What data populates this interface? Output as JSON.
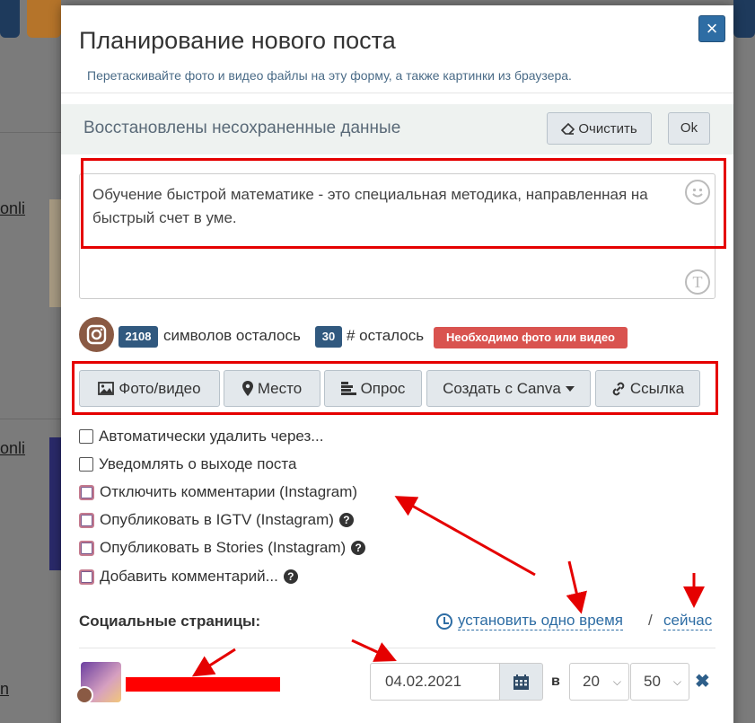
{
  "modal": {
    "title": "Планирование нового поста",
    "subtitle": "Перетаскивайте фото и видео файлы на эту форму, а также картинки из браузера.",
    "close_label": "×"
  },
  "background": {
    "link_1": "onli",
    "link_2": "onli",
    "link_3": "n"
  },
  "restored": {
    "text": "Восстановлены несохраненные данные",
    "clear_label": "Очистить",
    "ok_label": "Ok"
  },
  "editor": {
    "text": "Обучение быстрой математике - это специальная методика, направленная на быстрый счет в уме.",
    "emoji_icon": "smile-icon",
    "text_icon": "T"
  },
  "counters": {
    "chars_left": "2108",
    "chars_label": "символов осталось",
    "hashtags_left": "30",
    "hashtags_label": "# осталось",
    "warning": "Необходимо фото или видео"
  },
  "toolbar": {
    "photo_label": "Фото/видео",
    "place_label": "Место",
    "poll_label": "Опрос",
    "canva_label": "Создать с Canva",
    "link_label": "Ссылка"
  },
  "options": {
    "auto_delete": "Автоматически удалить через...",
    "notify": "Уведомлять о выходе поста",
    "disable_comments": "Отключить комментарии (Instagram)",
    "publish_igtv": "Опубликовать в IGTV (Instagram)",
    "publish_stories": "Опубликовать в Stories (Instagram)",
    "add_comment": "Добавить комментарий...",
    "help": "?"
  },
  "social": {
    "label": "Социальные страницы:",
    "set_one_time": "установить одно время",
    "separator": "/",
    "now": "сейчас",
    "date": "04.02.2021",
    "v_label": "в",
    "hour": "20",
    "minute": "50",
    "remove": "✖"
  },
  "colors": {
    "primary": "#2e6da4",
    "annotation_red": "#e50000",
    "badge_blue": "#31597f",
    "badge_red": "#d9534f"
  }
}
